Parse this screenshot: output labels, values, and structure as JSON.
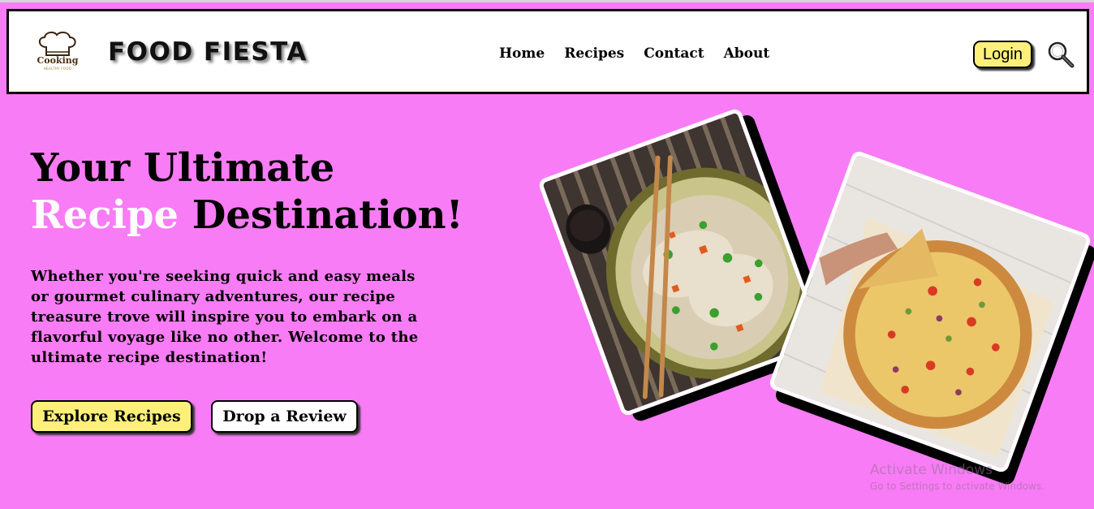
{
  "header": {
    "logo_text": "Cooking",
    "logo_subtext": "HEALTHY FOOD",
    "brand": "FOOD FIESTA",
    "nav": [
      "Home",
      "Recipes",
      "Contact",
      "About"
    ],
    "login_label": "Login"
  },
  "hero": {
    "title_line1": "Your Ultimate",
    "title_accent": "Recipe",
    "title_line2_rest": " Destination!",
    "description": "Whether you're seeking quick and easy meals or gourmet culinary adventures, our recipe treasure trove will inspire you to embark on a flavorful voyage like no other. Welcome to the ultimate recipe destination!",
    "explore_label": "Explore Recipes",
    "review_label": "Drop a Review"
  },
  "watermark": {
    "title": "Activate Windows",
    "subtitle": "Go to Settings to activate Windows."
  },
  "colors": {
    "background": "#f87cf5",
    "button_yellow": "#fdf07a",
    "accent_text": "#ffffff"
  },
  "icons": {
    "search": "magnifier-icon",
    "logo": "chef-hat-icon"
  }
}
